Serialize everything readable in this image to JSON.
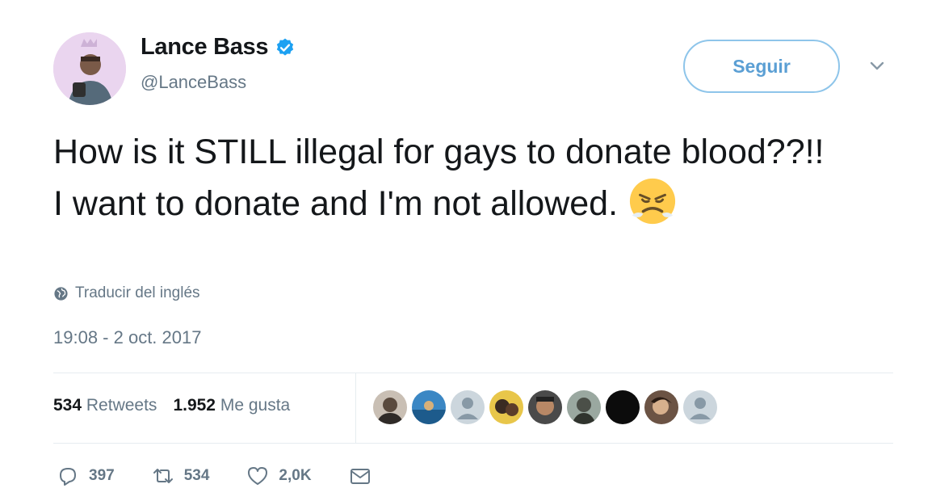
{
  "user": {
    "name": "Lance Bass",
    "handle": "@LanceBass",
    "verified": true
  },
  "follow_label": "Seguir",
  "tweet": {
    "text": "How is it STILL illegal for gays to donate blood??!! I want to donate and I'm not allowed.",
    "emoji": "angry-face-emoji",
    "translate_label": "Traducir del inglés",
    "timestamp": "19:08 - 2 oct. 2017"
  },
  "stats": {
    "retweets_count": "534",
    "retweets_label": "Retweets",
    "likes_count": "1.952",
    "likes_label": "Me gusta",
    "liker_avatars": 9
  },
  "actions": {
    "reply_count": "397",
    "retweet_count": "534",
    "like_count": "2,0K"
  },
  "colors": {
    "accent": "#1da1f2",
    "follow_border": "#8ec5ea",
    "muted_text": "#657786",
    "text": "#14171a"
  },
  "icons": [
    "verified-badge-icon",
    "chevron-down-icon",
    "globe-icon",
    "reply-icon",
    "retweet-icon",
    "like-icon",
    "message-icon"
  ]
}
